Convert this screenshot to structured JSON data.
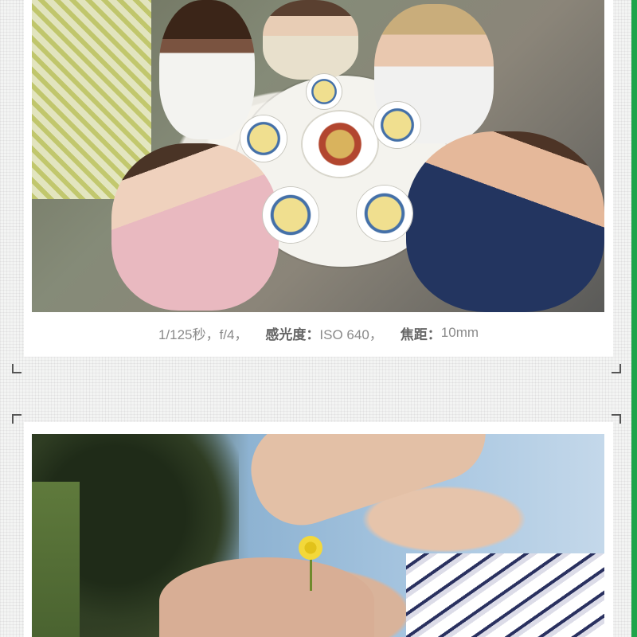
{
  "photos": [
    {
      "id_label": "photo-dinner-table"
    },
    {
      "id_label": "photo-woman-flower"
    }
  ],
  "caption": {
    "shutter": "1/125秒，f/4，",
    "iso_label": "感光度：",
    "iso_value": "ISO 640，",
    "focal_label": "焦距：",
    "focal_value": "10mm"
  },
  "colors": {
    "accent": "#1ea44a",
    "card": "#ffffff",
    "background": "#f3f4f3",
    "caption_text": "#8a8a8a"
  }
}
